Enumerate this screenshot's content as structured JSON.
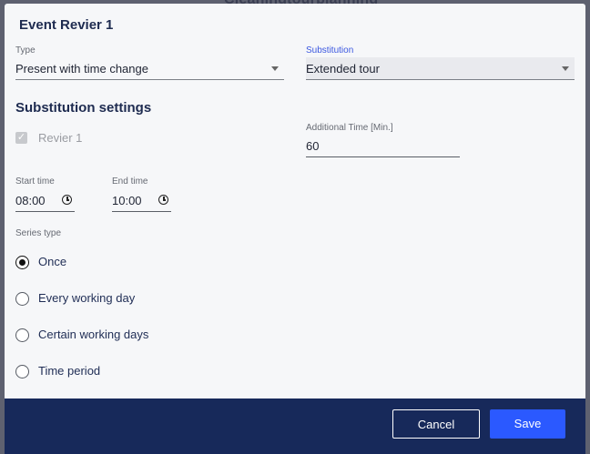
{
  "background": {
    "title": "Cleaningtourplanning"
  },
  "dialog": {
    "title": "Event Revier 1",
    "type": {
      "label": "Type",
      "value": "Present with time change"
    },
    "substitution": {
      "label": "Substitution",
      "value": "Extended tour"
    },
    "settings_heading": "Substitution settings",
    "revier": {
      "label": "Revier 1",
      "checked": true,
      "disabled": true
    },
    "additional_time": {
      "label": "Additional Time [Min.]",
      "value": "60"
    },
    "start_time": {
      "label": "Start time",
      "value": "08:00"
    },
    "end_time": {
      "label": "End time",
      "value": "10:00"
    },
    "series_type": {
      "label": "Series type",
      "options": [
        "Once",
        "Every working day",
        "Certain working days",
        "Time period"
      ],
      "selected": "Once"
    },
    "buttons": {
      "cancel": "Cancel",
      "save": "Save"
    }
  },
  "colors": {
    "primary": "#2b59ff",
    "footer": "#17295a",
    "accent_label": "#3b57e0"
  }
}
